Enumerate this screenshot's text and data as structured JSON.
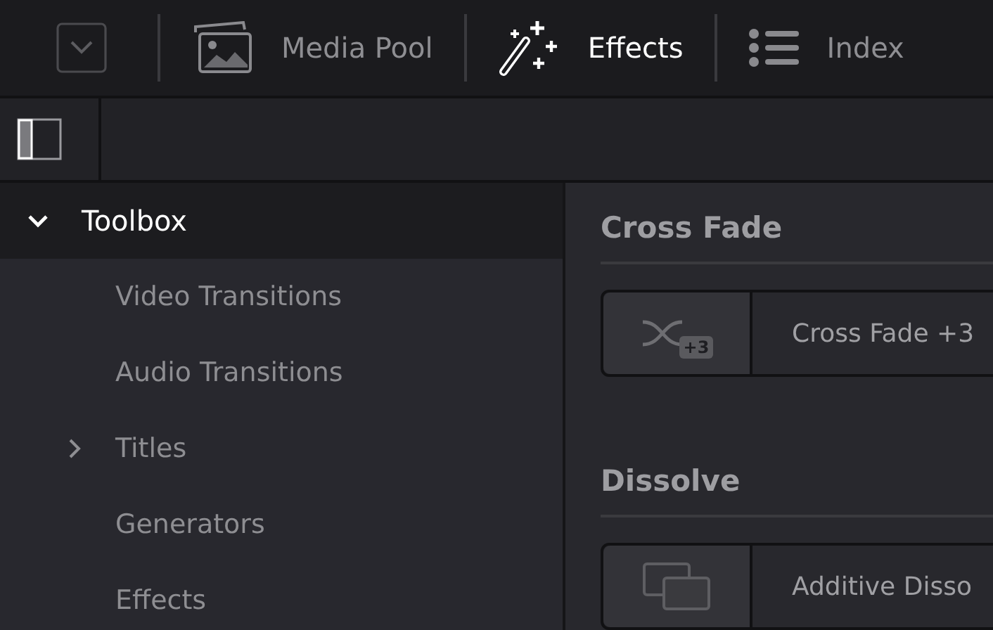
{
  "toolbar": [
    {
      "kind": "dropdown"
    },
    {
      "kind": "media",
      "label": "Media Pool",
      "selected": false
    },
    {
      "kind": "effects",
      "label": "Effects",
      "selected": true
    },
    {
      "kind": "index",
      "label": "Index",
      "selected": false
    }
  ],
  "sidebar": {
    "items": [
      {
        "label": "Toolbox",
        "expanded": true,
        "selected": true,
        "children": [
          {
            "label": "Video Transitions",
            "selected": false
          },
          {
            "label": "Audio Transitions",
            "selected": false
          },
          {
            "label": "Titles",
            "expanded": false,
            "selected": false
          },
          {
            "label": "Generators",
            "selected": false
          },
          {
            "label": "Effects",
            "selected": false
          }
        ]
      }
    ]
  },
  "sections": [
    {
      "title": "Cross Fade",
      "items": [
        {
          "kind": "crossfade",
          "badge": "+3",
          "label": "Cross Fade +3"
        }
      ]
    },
    {
      "title": "Dissolve",
      "items": [
        {
          "kind": "dissolve",
          "label": "Additive Disso"
        }
      ]
    }
  ]
}
